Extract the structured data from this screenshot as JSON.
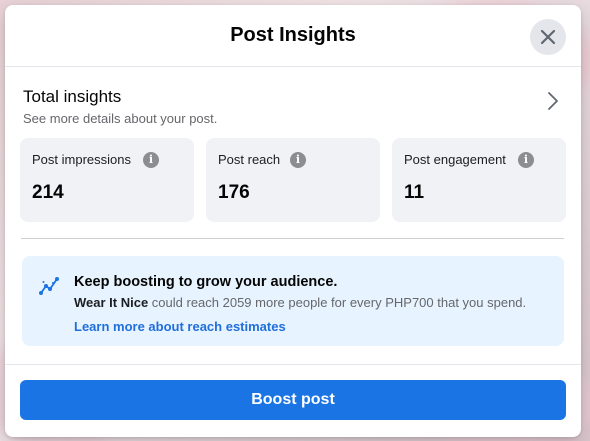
{
  "modal": {
    "title": "Post Insights",
    "close_icon": "close-icon"
  },
  "total_insights": {
    "title": "Total insights",
    "subtitle": "See more details about your post.",
    "icon": "chevron-right-icon"
  },
  "metrics": [
    {
      "label": "Post impressions",
      "value": "214",
      "icon": "info-icon"
    },
    {
      "label": "Post reach",
      "value": "176",
      "icon": "info-icon"
    },
    {
      "label": "Post engagement",
      "value": "11",
      "icon": "info-icon"
    }
  ],
  "boost_banner": {
    "icon": "trend-up-icon",
    "title": "Keep boosting to grow your audience.",
    "page_name": "Wear It Nice",
    "text": " could reach 2059 more people for every PHP700 that you spend.",
    "link": "Learn more about reach estimates"
  },
  "footer": {
    "boost_label": "Boost post"
  },
  "colors": {
    "primary": "#1b74e4",
    "link": "#216fdb",
    "banner_bg": "#e7f3ff",
    "card_bg": "#f0f2f5"
  }
}
